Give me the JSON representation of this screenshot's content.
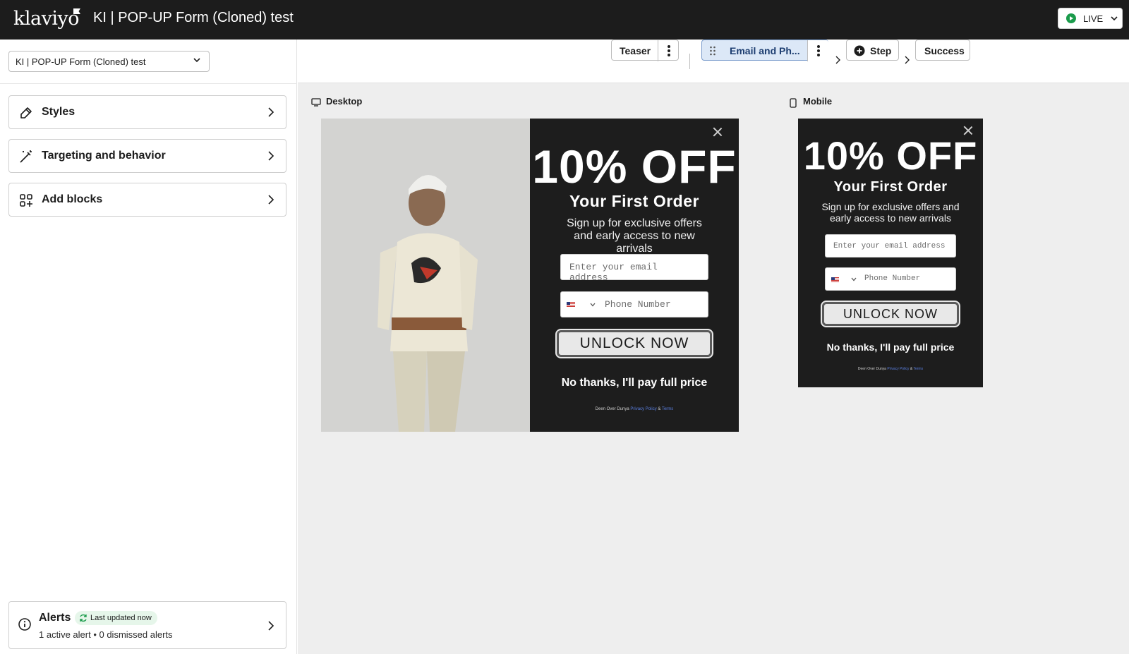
{
  "header": {
    "logo_text": "klaviyo",
    "title": "KI | POP-UP Form (Cloned) test",
    "status_label": "LIVE",
    "status_color": "#1a9b4b"
  },
  "sidebar": {
    "form_select_value": "KI | POP-UP Form (Cloned) test",
    "items": [
      {
        "label": "Styles",
        "icon": "brush-icon"
      },
      {
        "label": "Targeting and behavior",
        "icon": "wand-icon"
      },
      {
        "label": "Add blocks",
        "icon": "add-blocks-icon"
      }
    ],
    "alerts": {
      "title": "Alerts",
      "badge": "Last updated now",
      "summary": "1 active alert • 0 dismissed alerts"
    }
  },
  "steps": {
    "teaser": "Teaser",
    "email_phone": "Email and Ph...",
    "add_step": "Step",
    "success": "Success"
  },
  "preview": {
    "desktop_label": "Desktop",
    "mobile_label": "Mobile",
    "offer_title": "10% OFF",
    "offer_subtitle": "Your First Order",
    "offer_description": "Sign up for exclusive offers and early access to new arrivals",
    "email_placeholder": "Enter your email address",
    "phone_placeholder": "Phone Number",
    "cta_label": "UNLOCK NOW",
    "decline_label": "No thanks, I'll pay full price",
    "legal_brand": "Deen Over Dunya",
    "legal_privacy": "Privacy Policy",
    "legal_amp": "&",
    "legal_terms": "Terms"
  }
}
